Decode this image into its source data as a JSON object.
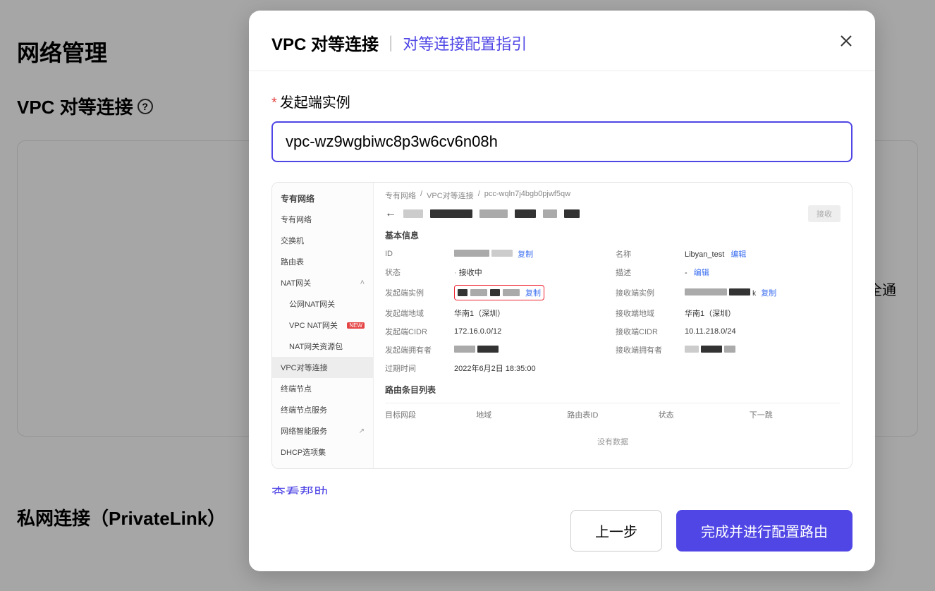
{
  "page": {
    "title": "网络管理",
    "section1": "VPC 对等连接",
    "section2": "私网连接（PrivateLink）",
    "bg_text_fragment": "邹安全通"
  },
  "modal": {
    "title": "VPC 对等连接",
    "guide_link": "对等连接配置指引",
    "field_label": "发起端实例",
    "input_value": "vpc-wz9wgbiwc8p3w6cv6n08h",
    "help_link": "查看帮助",
    "btn_prev": "上一步",
    "btn_submit": "完成并进行配置路由"
  },
  "embed": {
    "sidebar": {
      "title": "专有网络",
      "items": [
        {
          "label": "专有网络"
        },
        {
          "label": "交换机"
        },
        {
          "label": "路由表"
        },
        {
          "label": "NAT网关",
          "expandable": true
        },
        {
          "label": "公网NAT网关",
          "indent": true
        },
        {
          "label": "VPC NAT网关",
          "indent": true,
          "new": "NEW"
        },
        {
          "label": "NAT网关资源包",
          "indent": true
        },
        {
          "label": "VPC对等连接",
          "active": true
        },
        {
          "label": "终端节点"
        },
        {
          "label": "终端节点服务"
        },
        {
          "label": "网络智能服务",
          "ext": true
        },
        {
          "label": "DHCP选项集"
        }
      ]
    },
    "breadcrumb": [
      "专有网络",
      "VPC对等连接",
      "pcc-wqln7j4bgb0pjwf5qw"
    ],
    "action_btn": "接收",
    "basic_info_title": "基本信息",
    "copy": "复制",
    "edit": "编辑",
    "rows": {
      "id_lbl": "ID",
      "name_lbl": "名称",
      "name_val": "Libyan_test",
      "status_lbl": "状态",
      "status_val": "接收中",
      "desc_lbl": "描述",
      "desc_val": "-",
      "src_inst_lbl": "发起端实例",
      "dst_inst_lbl": "接收端实例",
      "src_region_lbl": "发起端地域",
      "src_region_val": "华南1（深圳）",
      "dst_region_lbl": "接收端地域",
      "dst_region_val": "华南1（深圳）",
      "src_cidr_lbl": "发起端CIDR",
      "src_cidr_val": "172.16.0.0/12",
      "dst_cidr_lbl": "接收端CIDR",
      "dst_cidr_val": "10.11.218.0/24",
      "src_owner_lbl": "发起端拥有者",
      "dst_owner_lbl": "接收端拥有者",
      "expire_lbl": "过期时间",
      "expire_val": "2022年6月2日 18:35:00"
    },
    "route_title": "路由条目列表",
    "route_cols": [
      "目标网段",
      "地域",
      "路由表ID",
      "状态",
      "下一跳"
    ],
    "route_empty": "没有数据"
  }
}
